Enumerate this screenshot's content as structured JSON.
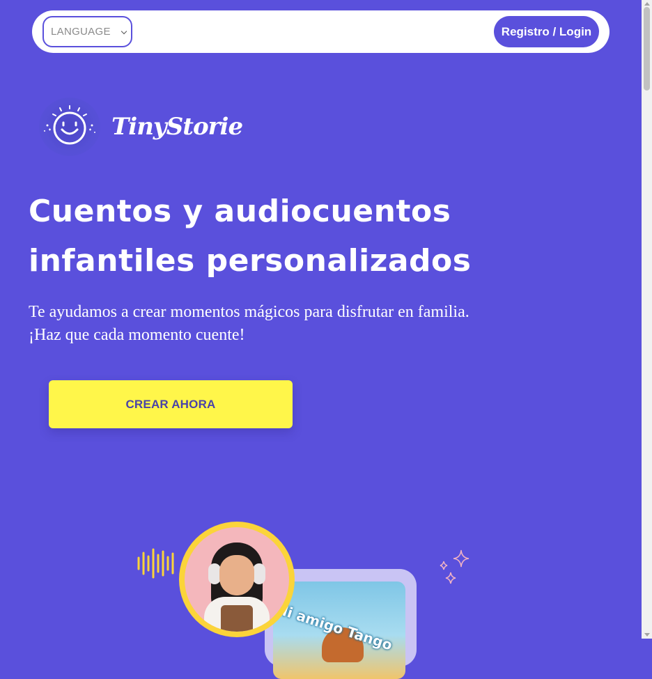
{
  "navbar": {
    "language_placeholder": "LANGUAGE",
    "login_label": "Registro / Login"
  },
  "logo": {
    "brand_name": "TinyStorie",
    "icon": "smiley-face-icon"
  },
  "hero": {
    "headline": "Cuentos y audiocuentos infantiles personalizados",
    "subtitle_line1": "Te ayudamos a crear momentos mágicos para disfrutar en familia.",
    "subtitle_line2": "¡Haz que cada momento cuente!",
    "cta_label": "CREAR AHORA"
  },
  "illustration": {
    "book_title": "Mi amigo Tango",
    "icons": [
      "sound-wave-icon",
      "sparkles-icon"
    ]
  },
  "colors": {
    "background": "#5a50dc",
    "cta_background": "#fff64a",
    "cta_text": "#4a43a8",
    "avatar_ring": "#fbd43a"
  }
}
